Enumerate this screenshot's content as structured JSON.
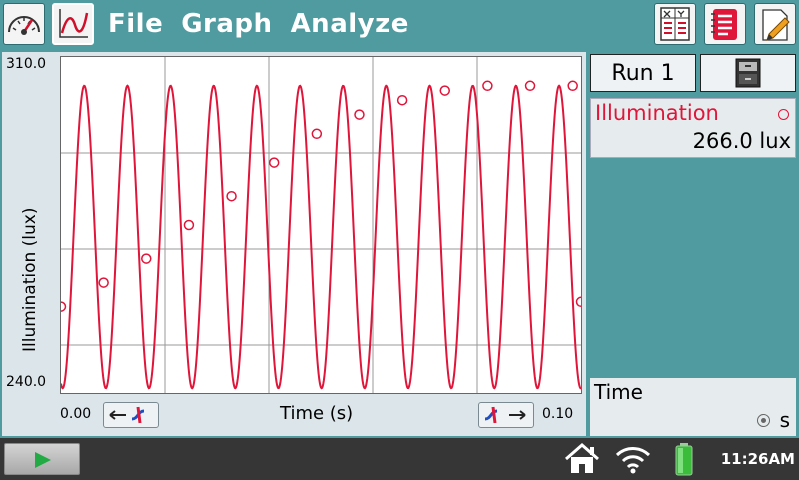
{
  "menu": {
    "file": "File",
    "graph": "Graph",
    "analyze": "Analyze"
  },
  "graph": {
    "y_max": "310.0",
    "y_min": "240.0",
    "y_label": "Illumination (lux)",
    "x_min": "0.00",
    "x_max": "0.10",
    "x_label": "Time (s)"
  },
  "run": {
    "label": "Run 1"
  },
  "meter": {
    "name": "Illumination",
    "value": "266.0 lux"
  },
  "time": {
    "label": "Time",
    "unit": "s"
  },
  "status": {
    "clock": "11:26AM"
  },
  "colors": {
    "trace": "#e0153a",
    "background": "#4f9ba0"
  },
  "chart_data": {
    "type": "line",
    "xlim": [
      0,
      0.1
    ],
    "ylim": [
      240,
      310
    ],
    "grid": true,
    "series": [
      {
        "style": "line",
        "period": 0.0083,
        "min": 241,
        "max": 304
      },
      {
        "style": "points",
        "x": [
          0.0,
          0.0082,
          0.0164,
          0.0246,
          0.0328,
          0.041,
          0.0492,
          0.0574,
          0.0656,
          0.0738,
          0.082,
          0.0902,
          0.0984,
          0.1
        ],
        "y": [
          258,
          263,
          268,
          275,
          281,
          288,
          294,
          298,
          301,
          303,
          304,
          304,
          304,
          259
        ]
      }
    ]
  }
}
